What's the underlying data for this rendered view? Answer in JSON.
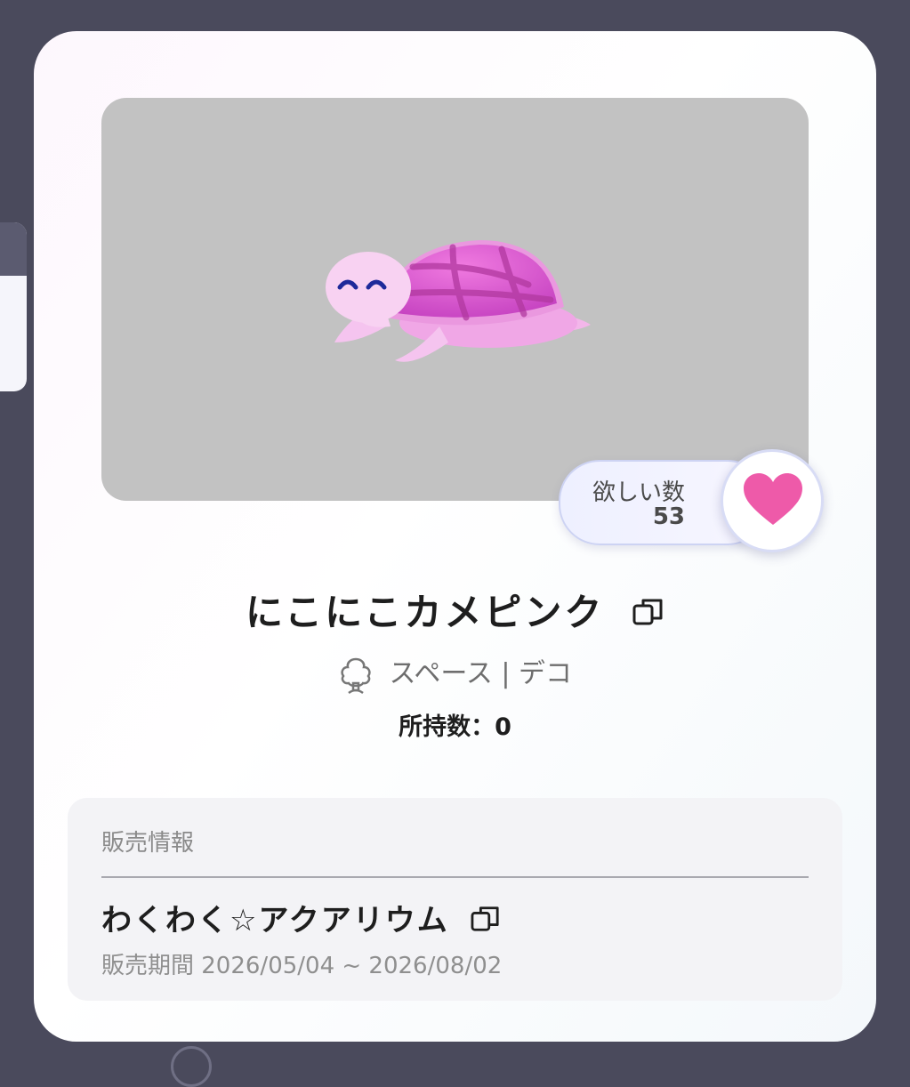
{
  "item": {
    "name": "にこにこカメピンク",
    "category": "スペース | デコ",
    "owned": "所持数：0",
    "wishlist_label": "欲しい数",
    "wishlist_count": "53"
  },
  "sales_info": {
    "header": "販売情報",
    "event_name": "わくわく☆アクアリウム",
    "period": "販売期間 2026/05/04 ~ 2026/08/02"
  },
  "colors": {
    "heart": "#ee5aa9",
    "image_bg": "#c2c2c2"
  },
  "icons": {
    "copy": "copy-icon",
    "category": "tree-icon",
    "wishlist": "heart-icon"
  }
}
